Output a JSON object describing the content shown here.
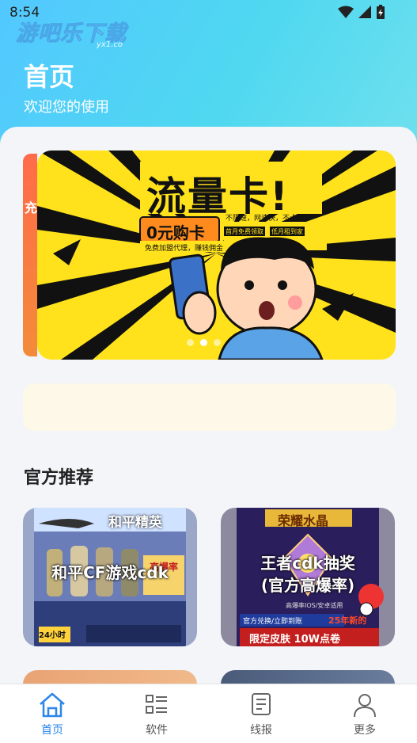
{
  "status_bar": {
    "time": "8:54"
  },
  "watermark": {
    "text": "游吧乐下载",
    "sub": "yx1.co"
  },
  "header": {
    "title": "首页",
    "subtitle": "欢迎您的使用"
  },
  "banner": {
    "headline": "流量卡!",
    "buy_label": "0元购卡",
    "features": "不限速，网速快，不卡顿",
    "tag1": "首月免费领取",
    "tag2": "低月租到家",
    "promo": "免费加盟代理，赚钱佣金",
    "left_peek_text": "充"
  },
  "section": {
    "title": "官方推荐"
  },
  "cards": [
    {
      "title": "和平CF游戏cdk",
      "banner_text": "和平精英",
      "badge_top": "高爆率",
      "badge_bottom": "24小时"
    },
    {
      "title_line1": "王者cdk抽奖",
      "title_line2": "(官方高爆率)",
      "banner_text": "荣耀水晶",
      "footer_text": "限定皮肤 10W点卷",
      "small_text": "官方兑换/立即到账",
      "year_text": "25年新的",
      "sub_text": "高爆率IOS/安卓适用"
    }
  ],
  "tabs": [
    {
      "label": "首页",
      "icon": "home-icon",
      "active": true
    },
    {
      "label": "软件",
      "icon": "list-icon",
      "active": false
    },
    {
      "label": "线报",
      "icon": "document-icon",
      "active": false
    },
    {
      "label": "更多",
      "icon": "person-icon",
      "active": false
    }
  ],
  "colors": {
    "accent": "#2b86e8",
    "header_start": "#52c8ff",
    "header_end": "#6fe0ee",
    "notice_bg": "#fdf8e7"
  }
}
